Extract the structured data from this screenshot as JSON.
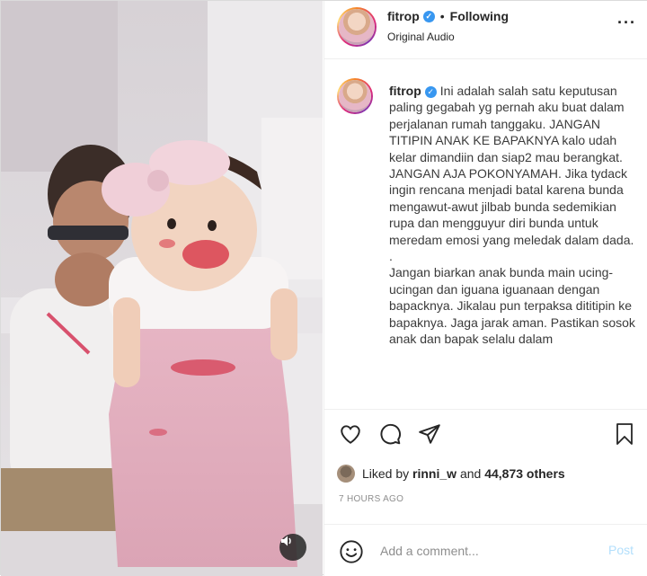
{
  "post": {
    "username": "fitrop",
    "follow_status": "Following",
    "audio": "Original Audio",
    "caption": "Ini adalah salah satu keputusan paling gegabah yg pernah aku buat dalam perjalanan rumah tanggaku. JANGAN TITIPIN ANAK KE BAPAKNYA kalo udah kelar dimandiin dan siap2 mau berangkat. JANGAN AJA POKONYAMAH. Jika tydack ingin rencana menjadi batal karena bunda mengawut-awut jilbab bunda sedemikian rupa dan mengguyur diri bunda untuk meredam emosi yang meledak dalam dada.\n.\nJangan biarkan anak bunda main ucing-ucingan dan iguana iguanaan dengan bapacknya. Jikalau pun terpaksa dititipin ke bapaknya. Jaga jarak aman. Pastikan sosok anak dan bapak selalu dalam",
    "liked_prefix": "Liked by ",
    "liked_user": "rinni_w",
    "liked_and": " and ",
    "liked_count": "44,873 others",
    "time": "7 HOURS AGO"
  },
  "comment": {
    "placeholder": "Add a comment...",
    "post_label": "Post"
  },
  "icons": {
    "verified": "verified-badge",
    "more": "more-options",
    "like": "heart-outline",
    "comment": "comment-bubble",
    "share": "paper-plane",
    "save": "bookmark-outline",
    "emoji": "smiley-face",
    "sound": "speaker-icon"
  },
  "colors": {
    "verified": "#3897f0",
    "post_disabled": "#b2dffc",
    "muted": "#8e8e8e"
  }
}
